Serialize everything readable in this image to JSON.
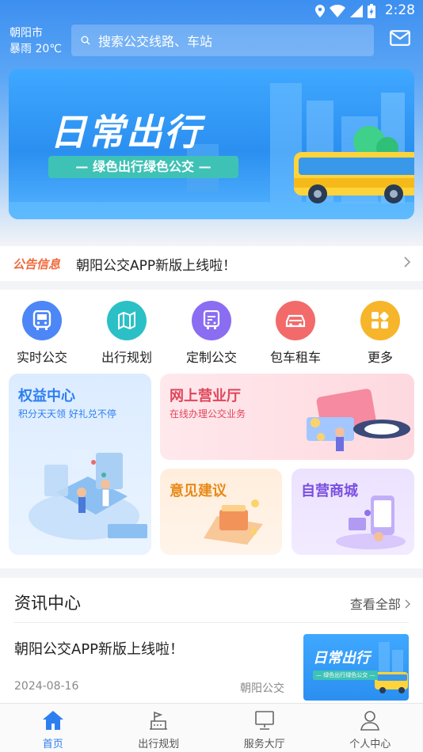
{
  "status_bar": {
    "time": "2:28"
  },
  "header": {
    "city": "朝阳市",
    "weather": "暴雨 20℃",
    "search_placeholder": "搜索公交线路、车站",
    "mail_icon": "mail-icon"
  },
  "banner": {
    "title": "日常出行",
    "subtitle": "— 绿色出行绿色公交 —"
  },
  "notice": {
    "tag": "公告信息",
    "message": "朝阳公交APP新版上线啦！"
  },
  "quick_actions": [
    {
      "label": "实时公交",
      "icon": "bus-icon",
      "color": "#4d86f7"
    },
    {
      "label": "出行规划",
      "icon": "map-icon",
      "color": "#2bc0c6"
    },
    {
      "label": "定制公交",
      "icon": "custom-bus-icon",
      "color": "#8b6df2"
    },
    {
      "label": "包车租车",
      "icon": "car-icon",
      "color": "#f26a6a"
    },
    {
      "label": "更多",
      "icon": "more-icon",
      "color": "#f6b52a"
    }
  ],
  "cards": {
    "benefits": {
      "title": "权益中心",
      "subtitle": "积分天天领 好礼兑不停"
    },
    "online_hall": {
      "title": "网上营业厅",
      "subtitle": "在线办理公交业务"
    },
    "feedback": {
      "title": "意见建议"
    },
    "mall": {
      "title": "自营商城"
    }
  },
  "news": {
    "section_title": "资讯中心",
    "view_all": "查看全部",
    "items": [
      {
        "title": "朝阳公交APP新版上线啦！",
        "date": "2024-08-16",
        "source": "朝阳公交",
        "thumb_title": "日常出行",
        "thumb_subtitle": "— 绿色出行绿色公交 —"
      }
    ]
  },
  "tabbar": [
    {
      "label": "首页",
      "icon": "home-icon",
      "active": true
    },
    {
      "label": "出行规划",
      "icon": "route-icon",
      "active": false
    },
    {
      "label": "服务大厅",
      "icon": "monitor-icon",
      "active": false
    },
    {
      "label": "个人中心",
      "icon": "user-icon",
      "active": false
    }
  ],
  "colors": {
    "accent": "#2d7ff0",
    "notice_tag": "#f06a3c"
  }
}
